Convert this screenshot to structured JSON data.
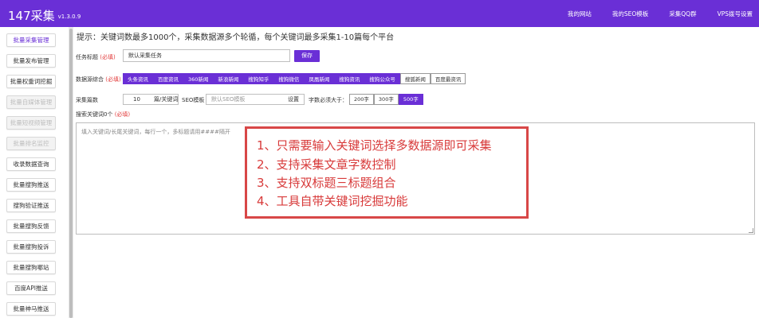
{
  "header": {
    "brand": "147采集",
    "version": "v1.3.0.9",
    "nav": [
      "我的网站",
      "我的SEO模板",
      "采集QQ群",
      "VPS拨号设置"
    ]
  },
  "sidebar": {
    "items": [
      {
        "label": "批量采集管理",
        "state": "active"
      },
      {
        "label": "批量发布管理",
        "state": "normal"
      },
      {
        "label": "批量权重词挖掘",
        "state": "normal"
      },
      {
        "label": "批量自媒体管理",
        "state": "disabled"
      },
      {
        "label": "批量短视频管理",
        "state": "disabled"
      },
      {
        "label": "批量排名监控",
        "state": "disabled"
      },
      {
        "label": "收录数据查询",
        "state": "normal"
      },
      {
        "label": "批量搜狗推送",
        "state": "normal"
      },
      {
        "label": "搜狗验证推送",
        "state": "normal"
      },
      {
        "label": "批量搜狗反馈",
        "state": "normal"
      },
      {
        "label": "批量搜狗投诉",
        "state": "normal"
      },
      {
        "label": "批量搜狗哪站",
        "state": "normal"
      },
      {
        "label": "百度API推送",
        "state": "normal"
      },
      {
        "label": "批量神马推送",
        "state": "normal"
      }
    ]
  },
  "main": {
    "tip": "提示：关键词数最多1000个，采集数据源多个轮循，每个关键词最多采集1-10篇每个平台",
    "task": {
      "label": "任务标题",
      "required": "(必填)",
      "value": "默认采集任务",
      "save": "保存"
    },
    "sources": {
      "label": "数据源综合",
      "required": "(必填)",
      "items": [
        {
          "label": "头条资讯",
          "on": true
        },
        {
          "label": "百度资讯",
          "on": true
        },
        {
          "label": "360新闻",
          "on": true
        },
        {
          "label": "新浪新闻",
          "on": true
        },
        {
          "label": "搜狗知乎",
          "on": true
        },
        {
          "label": "搜狗微信",
          "on": true
        },
        {
          "label": "凤凰新闻",
          "on": true
        },
        {
          "label": "搜狗资讯",
          "on": true
        },
        {
          "label": "搜狗公众号",
          "on": true
        },
        {
          "label": "搜狐新闻",
          "on": false
        },
        {
          "label": "百度最资讯",
          "on": false
        }
      ]
    },
    "count": {
      "label": "采集篇数",
      "value": "10",
      "unit": "篇/关键词",
      "seo_label": "SEO模板",
      "seo_placeholder": "默认SEO模板",
      "seo_setting": "设置",
      "wordcount_label": "字数必须大于：",
      "wordcounts": [
        {
          "label": "200字",
          "on": false
        },
        {
          "label": "300字",
          "on": false
        },
        {
          "label": "500字",
          "on": true
        }
      ]
    },
    "keywords": {
      "label": "搜索关键词0个",
      "required": "(必填)",
      "placeholder": "填入关键词/长尾关键词，每行一个，多标题请用####隔开"
    },
    "callout": [
      "1、只需要输入关键词选择多数据源即可采集",
      "2、支持采集文章字数控制",
      "3、支持双标题三标题组合",
      "4、工具自带关键词挖掘功能"
    ]
  },
  "colors": {
    "primary": "#6a2fd6",
    "callout": "#d84747"
  }
}
